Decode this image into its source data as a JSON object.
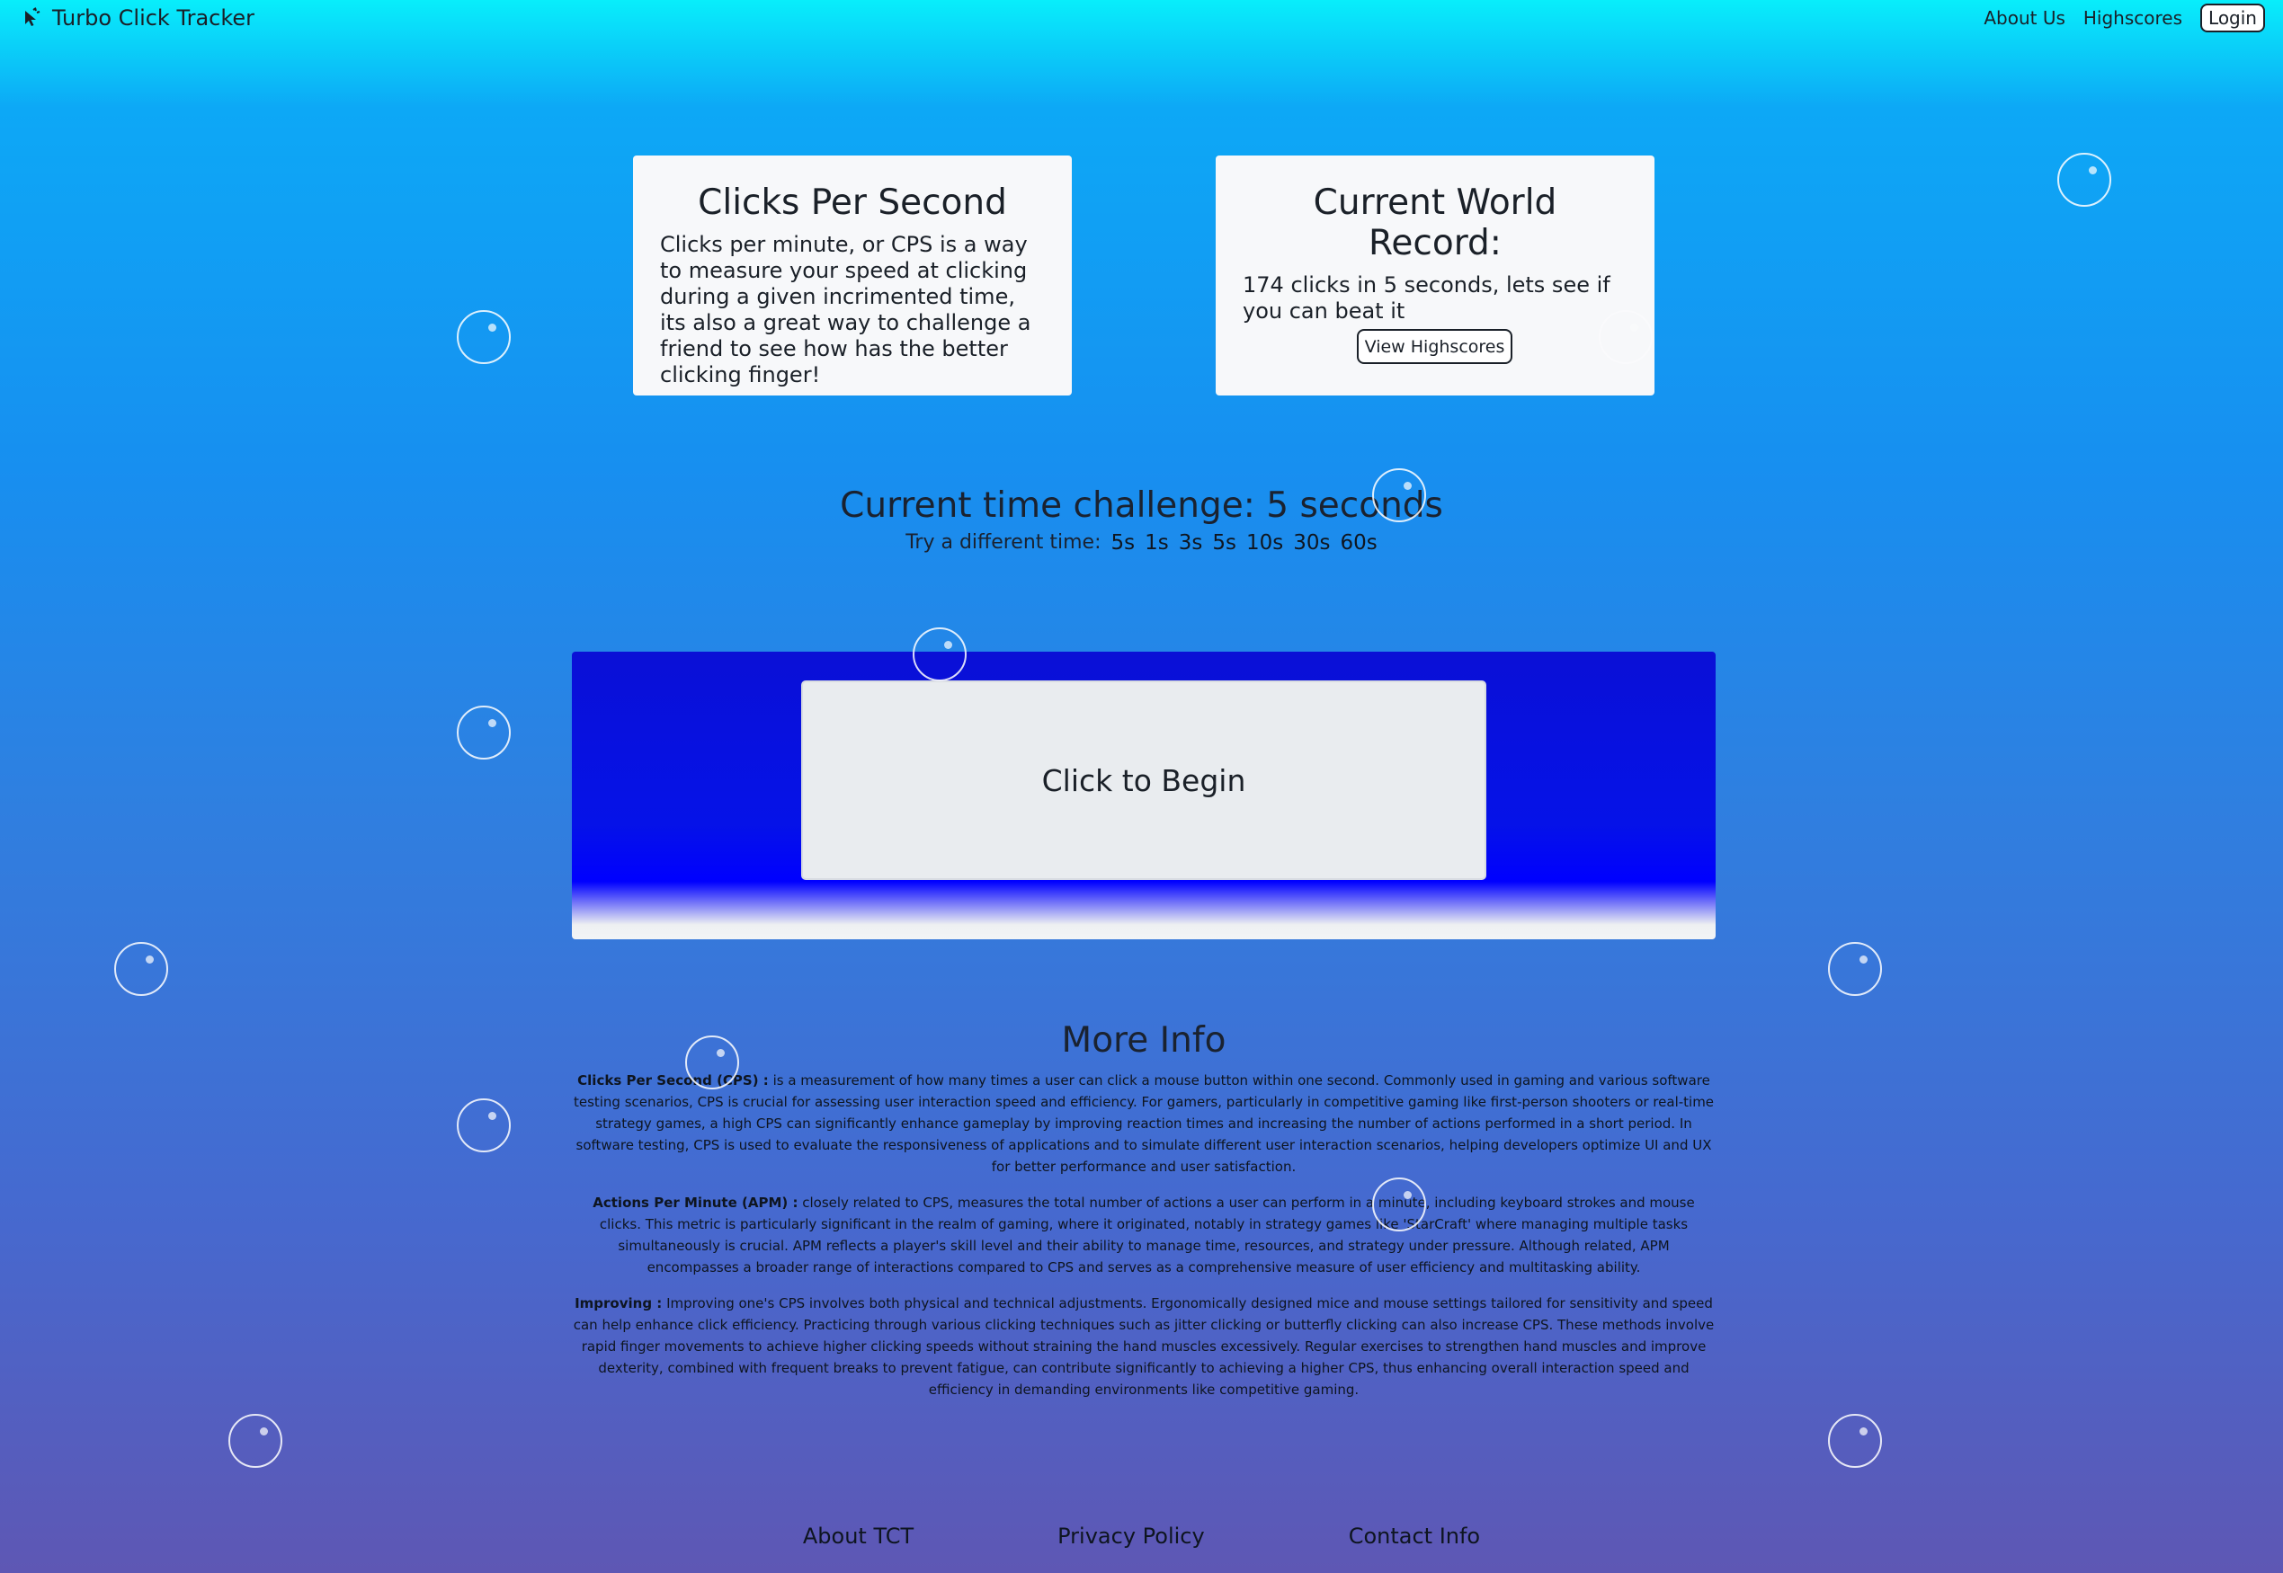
{
  "nav": {
    "brand": "Turbo Click Tracker",
    "links": [
      "About Us",
      "Highscores"
    ],
    "login": "Login"
  },
  "cards": {
    "cps": {
      "title": "Clicks Per Second",
      "body": "Clicks per minute, or CPS is a way to measure your speed at clicking during a given incrimented time, its also a great way to challenge a friend to see how has the better clicking finger!"
    },
    "record": {
      "title": "Current World Record:",
      "body": "174 clicks in 5 seconds, lets see if you can beat it",
      "button": "View Highscores"
    }
  },
  "challenge": {
    "title": "Current time challenge: 5 seconds",
    "try_label": "Try a different time:",
    "options": [
      "5s",
      "1s",
      "3s",
      "5s",
      "10s",
      "30s",
      "60s"
    ]
  },
  "click_area": {
    "button": "Click to Begin"
  },
  "more_info": {
    "title": "More Info",
    "sections": [
      {
        "term": "Clicks Per Second (CPS) :",
        "text": " is a measurement of how many times a user can click a mouse button within one second. Commonly used in gaming and various software testing scenarios, CPS is crucial for assessing user interaction speed and efficiency. For gamers, particularly in competitive gaming like first-person shooters or real-time strategy games, a high CPS can significantly enhance gameplay by improving reaction times and increasing the number of actions performed in a short period. In software testing, CPS is used to evaluate the responsiveness of applications and to simulate different user interaction scenarios, helping developers optimize UI and UX for better performance and user satisfaction."
      },
      {
        "term": "Actions Per Minute (APM) :",
        "text": " closely related to CPS, measures the total number of actions a user can perform in a minute, including keyboard strokes and mouse clicks. This metric is particularly significant in the realm of gaming, where it originated, notably in strategy games like 'StarCraft' where managing multiple tasks simultaneously is crucial. APM reflects a player's skill level and their ability to manage time, resources, and strategy under pressure. Although related, APM encompasses a broader range of interactions compared to CPS and serves as a comprehensive measure of user efficiency and multitasking ability."
      },
      {
        "term": "Improving :",
        "text": " Improving one's CPS involves both physical and technical adjustments. Ergonomically designed mice and mouse settings tailored for sensitivity and speed can help enhance click efficiency. Practicing through various clicking techniques such as jitter clicking or butterfly clicking can also increase CPS. These methods involve rapid finger movements to achieve higher clicking speeds without straining the hand muscles excessively. Regular exercises to strengthen hand muscles and improve dexterity, combined with frequent breaks to prevent fatigue, can contribute significantly to achieving a higher CPS, thus enhancing overall interaction speed and efficiency in demanding environments like competitive gaming."
      }
    ]
  },
  "footer": {
    "links": [
      "About TCT",
      "Privacy Policy",
      "Contact Info"
    ]
  }
}
